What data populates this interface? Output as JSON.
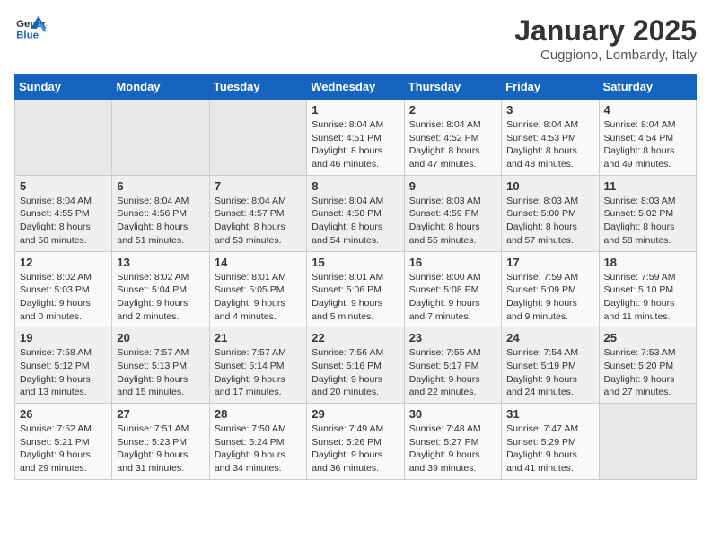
{
  "header": {
    "logo_general": "General",
    "logo_blue": "Blue",
    "title": "January 2025",
    "subtitle": "Cuggiono, Lombardy, Italy"
  },
  "days_of_week": [
    "Sunday",
    "Monday",
    "Tuesday",
    "Wednesday",
    "Thursday",
    "Friday",
    "Saturday"
  ],
  "weeks": [
    [
      {
        "day": "",
        "info": ""
      },
      {
        "day": "",
        "info": ""
      },
      {
        "day": "",
        "info": ""
      },
      {
        "day": "1",
        "info": "Sunrise: 8:04 AM\nSunset: 4:51 PM\nDaylight: 8 hours and 46 minutes."
      },
      {
        "day": "2",
        "info": "Sunrise: 8:04 AM\nSunset: 4:52 PM\nDaylight: 8 hours and 47 minutes."
      },
      {
        "day": "3",
        "info": "Sunrise: 8:04 AM\nSunset: 4:53 PM\nDaylight: 8 hours and 48 minutes."
      },
      {
        "day": "4",
        "info": "Sunrise: 8:04 AM\nSunset: 4:54 PM\nDaylight: 8 hours and 49 minutes."
      }
    ],
    [
      {
        "day": "5",
        "info": "Sunrise: 8:04 AM\nSunset: 4:55 PM\nDaylight: 8 hours and 50 minutes."
      },
      {
        "day": "6",
        "info": "Sunrise: 8:04 AM\nSunset: 4:56 PM\nDaylight: 8 hours and 51 minutes."
      },
      {
        "day": "7",
        "info": "Sunrise: 8:04 AM\nSunset: 4:57 PM\nDaylight: 8 hours and 53 minutes."
      },
      {
        "day": "8",
        "info": "Sunrise: 8:04 AM\nSunset: 4:58 PM\nDaylight: 8 hours and 54 minutes."
      },
      {
        "day": "9",
        "info": "Sunrise: 8:03 AM\nSunset: 4:59 PM\nDaylight: 8 hours and 55 minutes."
      },
      {
        "day": "10",
        "info": "Sunrise: 8:03 AM\nSunset: 5:00 PM\nDaylight: 8 hours and 57 minutes."
      },
      {
        "day": "11",
        "info": "Sunrise: 8:03 AM\nSunset: 5:02 PM\nDaylight: 8 hours and 58 minutes."
      }
    ],
    [
      {
        "day": "12",
        "info": "Sunrise: 8:02 AM\nSunset: 5:03 PM\nDaylight: 9 hours and 0 minutes."
      },
      {
        "day": "13",
        "info": "Sunrise: 8:02 AM\nSunset: 5:04 PM\nDaylight: 9 hours and 2 minutes."
      },
      {
        "day": "14",
        "info": "Sunrise: 8:01 AM\nSunset: 5:05 PM\nDaylight: 9 hours and 4 minutes."
      },
      {
        "day": "15",
        "info": "Sunrise: 8:01 AM\nSunset: 5:06 PM\nDaylight: 9 hours and 5 minutes."
      },
      {
        "day": "16",
        "info": "Sunrise: 8:00 AM\nSunset: 5:08 PM\nDaylight: 9 hours and 7 minutes."
      },
      {
        "day": "17",
        "info": "Sunrise: 7:59 AM\nSunset: 5:09 PM\nDaylight: 9 hours and 9 minutes."
      },
      {
        "day": "18",
        "info": "Sunrise: 7:59 AM\nSunset: 5:10 PM\nDaylight: 9 hours and 11 minutes."
      }
    ],
    [
      {
        "day": "19",
        "info": "Sunrise: 7:58 AM\nSunset: 5:12 PM\nDaylight: 9 hours and 13 minutes."
      },
      {
        "day": "20",
        "info": "Sunrise: 7:57 AM\nSunset: 5:13 PM\nDaylight: 9 hours and 15 minutes."
      },
      {
        "day": "21",
        "info": "Sunrise: 7:57 AM\nSunset: 5:14 PM\nDaylight: 9 hours and 17 minutes."
      },
      {
        "day": "22",
        "info": "Sunrise: 7:56 AM\nSunset: 5:16 PM\nDaylight: 9 hours and 20 minutes."
      },
      {
        "day": "23",
        "info": "Sunrise: 7:55 AM\nSunset: 5:17 PM\nDaylight: 9 hours and 22 minutes."
      },
      {
        "day": "24",
        "info": "Sunrise: 7:54 AM\nSunset: 5:19 PM\nDaylight: 9 hours and 24 minutes."
      },
      {
        "day": "25",
        "info": "Sunrise: 7:53 AM\nSunset: 5:20 PM\nDaylight: 9 hours and 27 minutes."
      }
    ],
    [
      {
        "day": "26",
        "info": "Sunrise: 7:52 AM\nSunset: 5:21 PM\nDaylight: 9 hours and 29 minutes."
      },
      {
        "day": "27",
        "info": "Sunrise: 7:51 AM\nSunset: 5:23 PM\nDaylight: 9 hours and 31 minutes."
      },
      {
        "day": "28",
        "info": "Sunrise: 7:50 AM\nSunset: 5:24 PM\nDaylight: 9 hours and 34 minutes."
      },
      {
        "day": "29",
        "info": "Sunrise: 7:49 AM\nSunset: 5:26 PM\nDaylight: 9 hours and 36 minutes."
      },
      {
        "day": "30",
        "info": "Sunrise: 7:48 AM\nSunset: 5:27 PM\nDaylight: 9 hours and 39 minutes."
      },
      {
        "day": "31",
        "info": "Sunrise: 7:47 AM\nSunset: 5:29 PM\nDaylight: 9 hours and 41 minutes."
      },
      {
        "day": "",
        "info": ""
      }
    ]
  ]
}
